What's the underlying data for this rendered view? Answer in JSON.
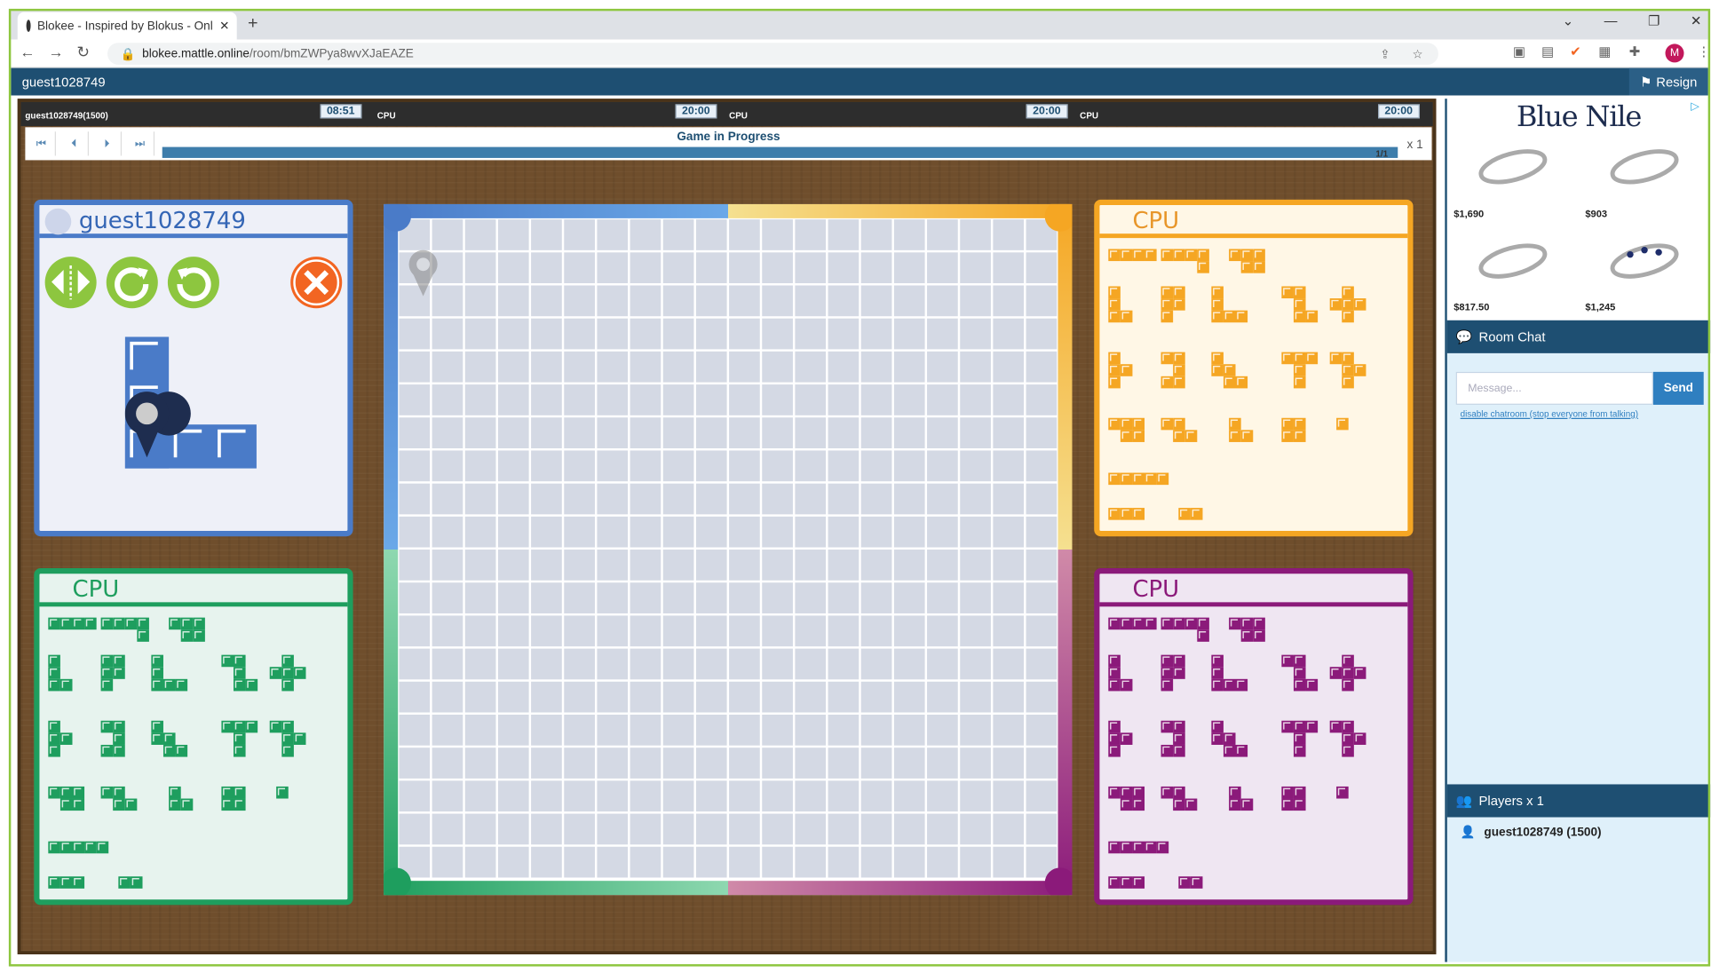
{
  "browser": {
    "tab_title": "Blokee - Inspired by Blokus - Onl",
    "url_host": "blokee.mattle.online",
    "url_path": "/room/bmZWPya8wvXJaEAZE",
    "avatar_letter": "M"
  },
  "app": {
    "username": "guest1028749",
    "resign_label": "Resign"
  },
  "clocks": {
    "player_label": "guest1028749(1500)",
    "items": [
      {
        "time": "08:51",
        "next_label": "CPU"
      },
      {
        "time": "20:00",
        "next_label": "CPU"
      },
      {
        "time": "20:00",
        "next_label": "CPU"
      },
      {
        "time": "20:00",
        "next_label": ""
      }
    ]
  },
  "replay": {
    "status": "Game in Progress",
    "page": "1/1",
    "speed": "x 1"
  },
  "panels": {
    "blue": {
      "name": "guest1028749",
      "color": "#4a7bc8"
    },
    "yellow": {
      "name": "CPU",
      "color": "#f5a623"
    },
    "green": {
      "name": "CPU",
      "color": "#1e9e5e"
    },
    "purple": {
      "name": "CPU",
      "color": "#8b1a7a"
    }
  },
  "controls": [
    "flip-icon",
    "rotate-cw-icon",
    "rotate-ccw-icon",
    "cancel-icon"
  ],
  "board": {
    "size": 20
  },
  "sidebar": {
    "ad": {
      "brand": "Blue Nile",
      "prices": [
        "$1,690",
        "$903",
        "$817.50",
        "$1,245"
      ]
    },
    "chat_title": "Room Chat",
    "message_placeholder": "Message...",
    "send_label": "Send",
    "disable_link": "disable chatroom (stop everyone from talking)",
    "players_title": "Players x 1",
    "players": [
      "guest1028749 (1500)"
    ]
  }
}
